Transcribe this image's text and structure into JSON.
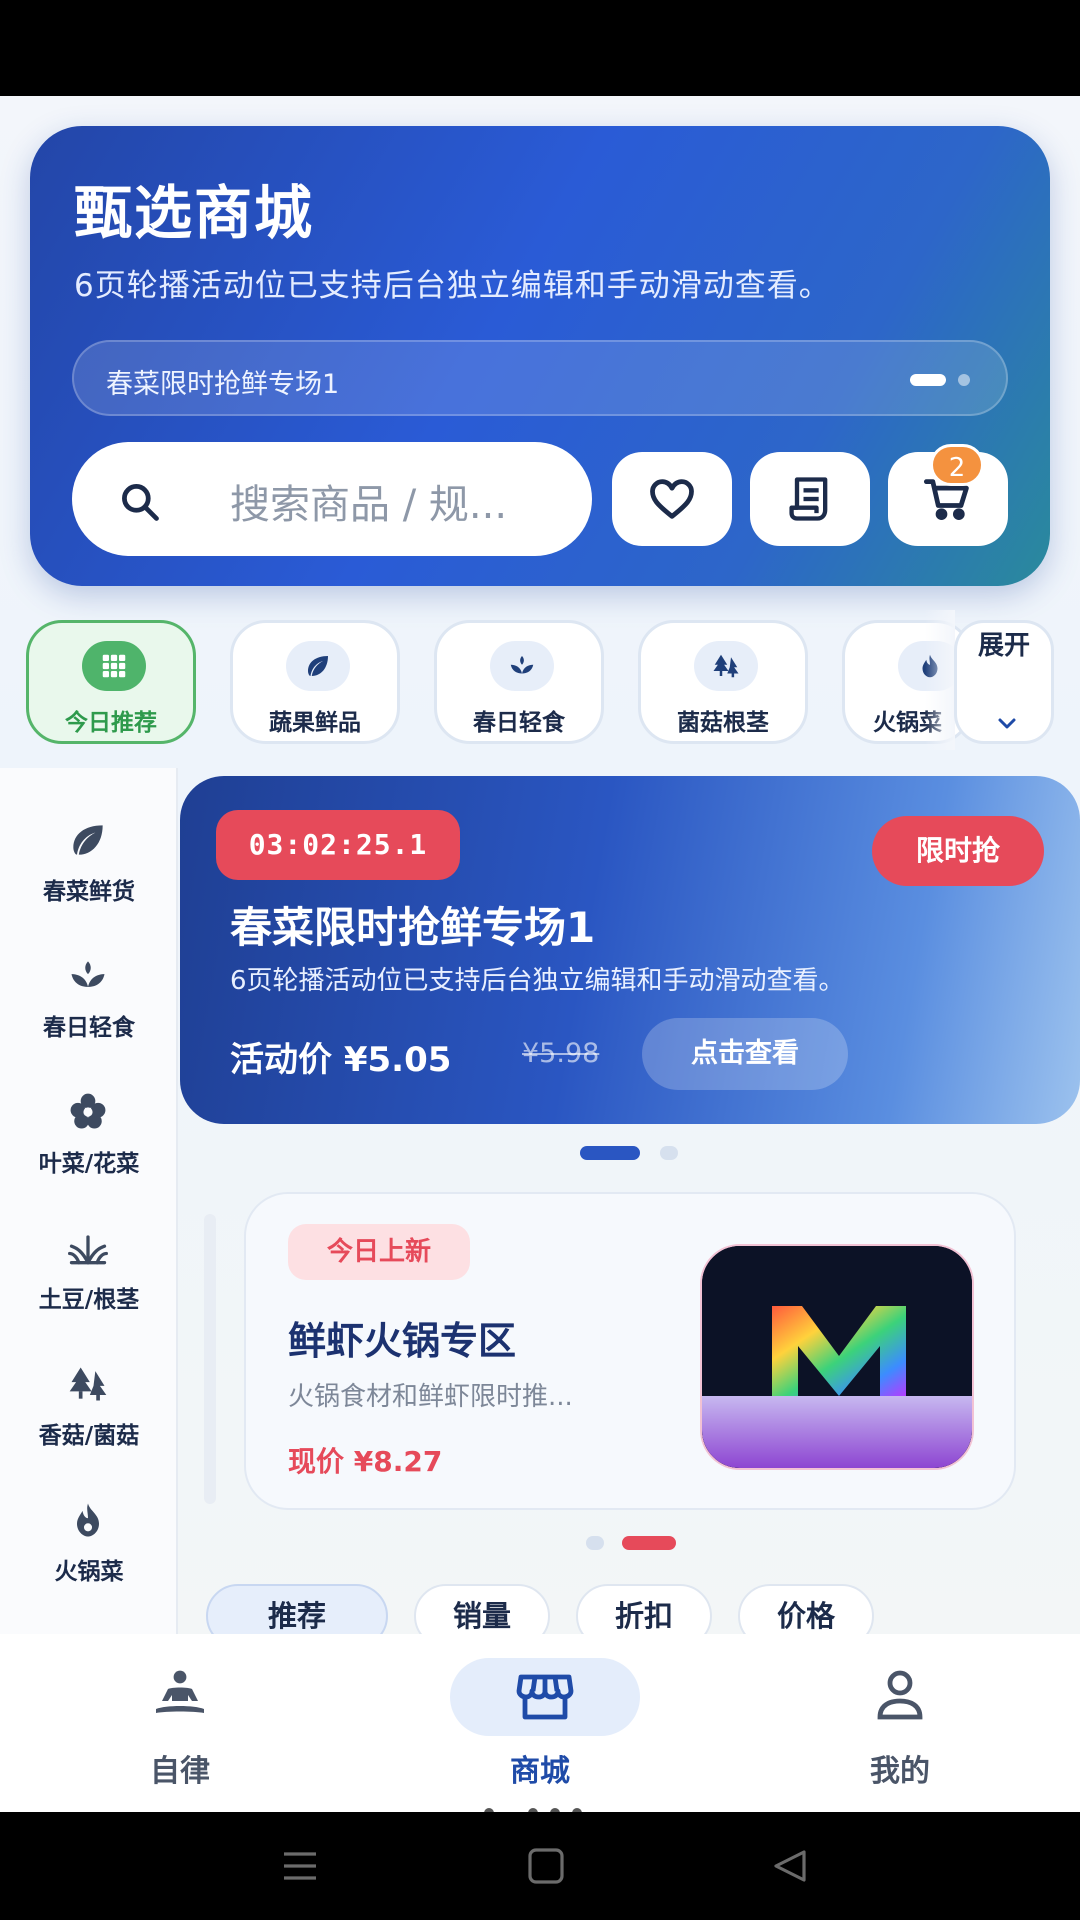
{
  "hero": {
    "title": "甄选商城",
    "subtitle": "6页轮播活动位已支持后台独立编辑和手动滑动查看。",
    "ticker": "春菜限时抢鲜专场1",
    "search_placeholder": "搜索商品 / 规...",
    "cart_count": "2",
    "buttons": [
      "heart-icon",
      "receipt-icon",
      "cart-icon"
    ]
  },
  "categories": [
    {
      "label": "今日推荐",
      "icon": "grid-icon",
      "active": true
    },
    {
      "label": "蔬果鲜品",
      "icon": "leaf-icon"
    },
    {
      "label": "春日轻食",
      "icon": "sprout-icon"
    },
    {
      "label": "菌菇根茎",
      "icon": "trees-icon"
    },
    {
      "label": "火锅菜",
      "icon": "flame-icon"
    }
  ],
  "expand_label": "展开",
  "sidebar": [
    {
      "label": "春菜鲜货",
      "icon": "leaf-icon"
    },
    {
      "label": "春日轻食",
      "icon": "sprout-icon"
    },
    {
      "label": "叶菜/花菜",
      "icon": "flower-icon"
    },
    {
      "label": "土豆/根茎",
      "icon": "grass-icon"
    },
    {
      "label": "香菇/菌菇",
      "icon": "trees-icon"
    },
    {
      "label": "火锅菜",
      "icon": "flame-icon"
    }
  ],
  "flash": {
    "timer": "03:02:25.1",
    "tag": "限时抢",
    "title": "春菜限时抢鲜专场1",
    "subtitle": "6页轮播活动位已支持后台独立编辑和手动滑动查看。",
    "price": "活动价 ¥5.05",
    "old_price": "¥5.98",
    "button": "点击查看"
  },
  "product": {
    "tag": "今日上新",
    "title": "鲜虾火锅专区",
    "desc": "火锅食材和鲜虾限时推...",
    "price": "现价 ¥8.27",
    "image_letter": "M"
  },
  "sort": [
    "推荐",
    "销量",
    "折扣",
    "价格"
  ],
  "nav": [
    {
      "label": "自律",
      "icon": "meditation-icon"
    },
    {
      "label": "商城",
      "icon": "store-icon",
      "active": true
    },
    {
      "label": "我的",
      "icon": "user-icon"
    }
  ],
  "colors": {
    "primary": "#2a56c2",
    "accent_red": "#e64a5a",
    "green": "#4fb46b",
    "badge_orange": "#f4923f"
  }
}
